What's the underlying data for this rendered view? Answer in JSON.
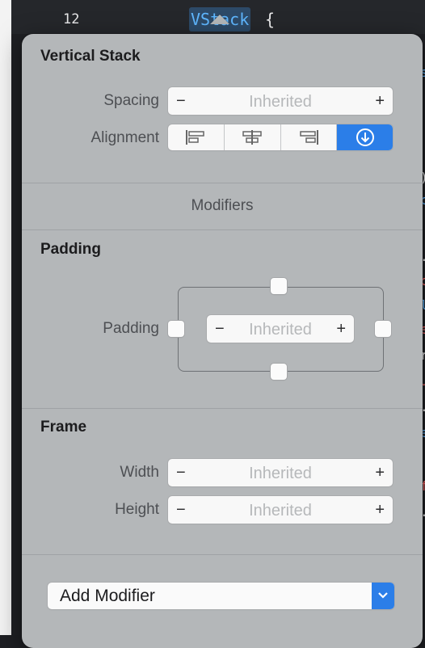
{
  "editor": {
    "line_number": "12",
    "code_keyword": "VStack",
    "code_brace": "{"
  },
  "popover": {
    "vertical_stack": {
      "title": "Vertical Stack",
      "spacing_label": "Spacing",
      "spacing_value": "Inherited",
      "alignment_label": "Alignment",
      "alignment_options": [
        {
          "icon": "align-leading-icon",
          "selected": false
        },
        {
          "icon": "align-center-icon",
          "selected": false
        },
        {
          "icon": "align-trailing-icon",
          "selected": false
        },
        {
          "icon": "arrow-down-circle-icon",
          "selected": true
        }
      ]
    },
    "modifiers_label": "Modifiers",
    "padding": {
      "title": "Padding",
      "label": "Padding",
      "value": "Inherited"
    },
    "frame": {
      "title": "Frame",
      "width_label": "Width",
      "width_value": "Inherited",
      "height_label": "Height",
      "height_value": "Inherited"
    },
    "add_modifier": {
      "label": "Add Modifier"
    }
  },
  "colors": {
    "accent": "#2b7ee8",
    "popover_bg": "#b4b7b9",
    "editor_bg": "#1f2024",
    "keyword": "#5fb7ff"
  }
}
